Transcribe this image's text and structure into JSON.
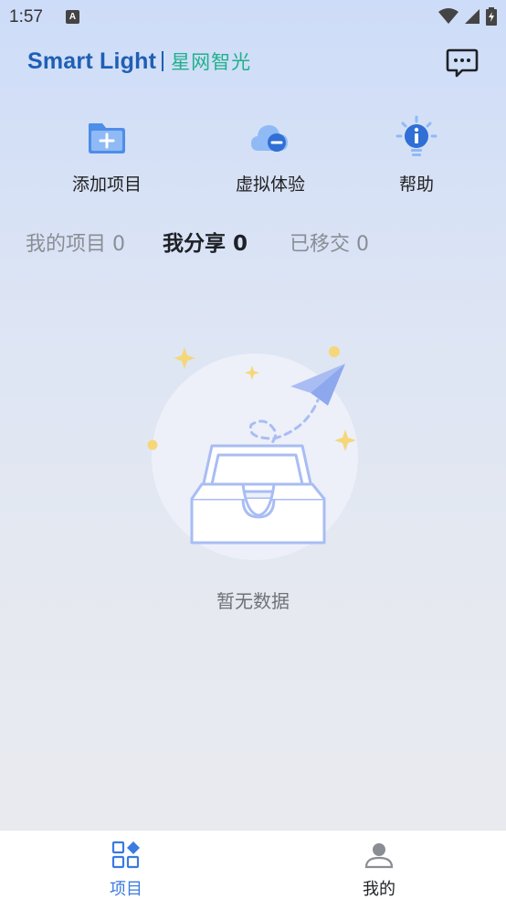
{
  "status_bar": {
    "time": "1:57",
    "notification_glyph": "A"
  },
  "header": {
    "brand_en": "Smart Light",
    "brand_cn": "星网智光",
    "message_icon": "chat-bubble-icon"
  },
  "actions": [
    {
      "label": "添加项目",
      "icon": "folder-add-icon"
    },
    {
      "label": "虚拟体验",
      "icon": "cloud-icon"
    },
    {
      "label": "帮助",
      "icon": "info-bulb-icon"
    }
  ],
  "tabs": [
    {
      "label": "我的项目 0",
      "active": false
    },
    {
      "label": "我分享 0",
      "active": true
    },
    {
      "label": "已移交 0",
      "active": false
    }
  ],
  "empty_state": {
    "text": "暂无数据",
    "icon": "empty-inbox-paper-plane-icon"
  },
  "bottom_nav": [
    {
      "label": "项目",
      "icon": "grid-icon",
      "active": true
    },
    {
      "label": "我的",
      "icon": "person-icon",
      "active": false
    }
  ],
  "colors": {
    "brand_blue": "#1f5fb5",
    "brand_green": "#1fb08c",
    "accent_blue": "#3a7be0",
    "illustration": "#a9bdf3"
  }
}
